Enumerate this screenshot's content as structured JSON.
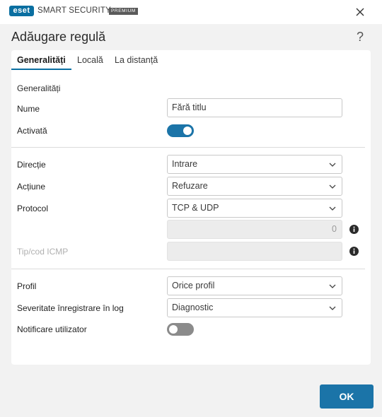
{
  "app": {
    "logo_text": "eset",
    "product_name": "SMART SECURITY",
    "edition": "PREMIUM"
  },
  "dialog": {
    "title": "Adăugare regulă",
    "help_label": "?",
    "ok_label": "OK"
  },
  "tabs": [
    {
      "label": "Generalități",
      "active": true
    },
    {
      "label": "Locală",
      "active": false
    },
    {
      "label": "La distanță",
      "active": false
    }
  ],
  "general": {
    "section_label": "Generalități",
    "name_label": "Nume",
    "name_value": "Fără titlu",
    "enabled_label": "Activată",
    "enabled": true
  },
  "rule": {
    "direction_label": "Direcție",
    "direction_value": "Intrare",
    "action_label": "Acțiune",
    "action_value": "Refuzare",
    "protocol_label": "Protocol",
    "protocol_value": "TCP & UDP",
    "protocol_number_value": "0",
    "icmp_label": "Tip/cod ICMP",
    "icmp_value": ""
  },
  "profile": {
    "profile_label": "Profil",
    "profile_value": "Orice profil",
    "log_severity_label": "Severitate înregistrare în log",
    "log_severity_value": "Diagnostic",
    "notify_label": "Notificare utilizator",
    "notify": false
  },
  "colors": {
    "accent": "#1b74a8",
    "brand": "#0a6fa1"
  }
}
